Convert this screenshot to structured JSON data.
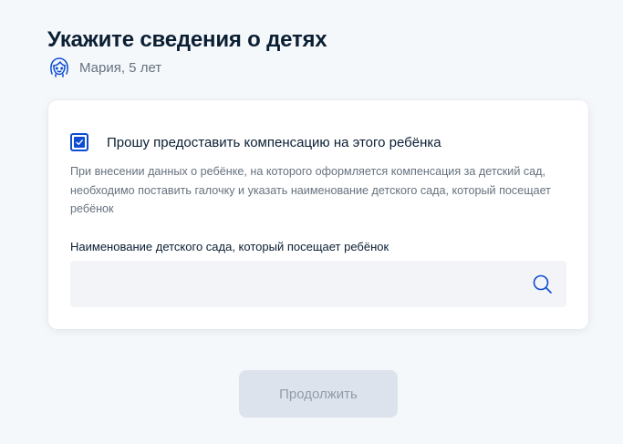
{
  "page": {
    "title": "Укажите сведения о детях"
  },
  "child": {
    "icon": "child-face-icon",
    "name": "Мария, 5 лет"
  },
  "form": {
    "checkbox_label": "Прошу предоставить компенсацию на этого ребёнка",
    "checkbox_checked": true,
    "hint": "При внесении данных о ребёнке, на которого оформляется компенсация за детский сад, необходимо поставить галочку и указать наименование детского сада, который посещает ребёнок",
    "field_label": "Наименование детского сада, который посещает ребёнок",
    "field_value": "",
    "field_icon": "search-icon"
  },
  "actions": {
    "continue_label": "Продолжить"
  },
  "colors": {
    "accent": "#0d4cd3",
    "text_primary": "#0b1f33",
    "text_secondary": "#66727f",
    "button_disabled_bg": "#dde3ec",
    "button_disabled_text": "#8f9cab",
    "page_bg": "#f5f8fb"
  }
}
